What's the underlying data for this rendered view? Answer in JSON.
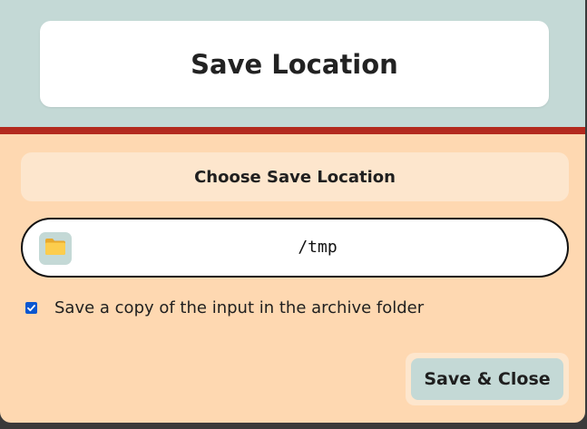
{
  "dialog": {
    "title": "Save Location"
  },
  "section": {
    "label": "Choose Save Location"
  },
  "path_field": {
    "value": "/tmp",
    "icon": "folder-icon"
  },
  "archive_option": {
    "label": "Save a copy of the input in the archive folder",
    "checked": true
  },
  "actions": {
    "save_close_label": "Save & Close"
  },
  "colors": {
    "header_bg": "#c4d9d6",
    "body_bg": "#fed8b1",
    "divider": "#b32a1e",
    "section_bg": "#fde6cd",
    "button_bg": "#c4d9d6",
    "checkbox_accent": "#0b57d0"
  }
}
